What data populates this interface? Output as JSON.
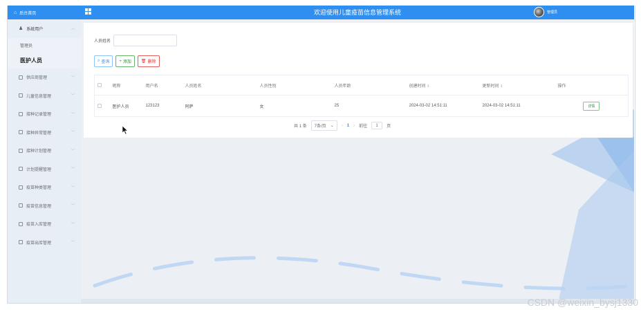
{
  "sidebar": {
    "home_label": "后台首页",
    "menus": [
      {
        "label": "系统用户",
        "open": true,
        "icon": "user-icon"
      },
      {
        "label": "供应商管理"
      },
      {
        "label": "儿童信息管理"
      },
      {
        "label": "接种记录管理"
      },
      {
        "label": "接种异常管理"
      },
      {
        "label": "接种计划管理"
      },
      {
        "label": "计划提醒管理"
      },
      {
        "label": "疫苗种类管理"
      },
      {
        "label": "疫苗信息管理"
      },
      {
        "label": "疫苗入库管理"
      },
      {
        "label": "疫苗出库管理"
      }
    ],
    "submenus": [
      {
        "label": "管理员"
      },
      {
        "label": "医护人员",
        "active": true
      }
    ]
  },
  "header": {
    "title": "欢迎使用儿童疫苗信息管理系统",
    "username": "管理员"
  },
  "search": {
    "label": "人员姓名",
    "value": "",
    "placeholder": ""
  },
  "buttons": {
    "query": "查询",
    "add": "添加",
    "delete": "删除"
  },
  "table": {
    "columns": [
      "",
      "昵称",
      "用户名",
      "人员姓名",
      "人员性别",
      "人员年龄",
      "创建时间",
      "更新时间",
      "操作"
    ],
    "sortable": [
      6,
      7
    ],
    "rows": [
      {
        "nickname": "医护人员",
        "username": "123123",
        "name": "阿萨",
        "gender": "女",
        "age": "25",
        "created": "2024-03-02 14:51:11",
        "updated": "2024-03-02 14:51:11",
        "action": "详情"
      }
    ]
  },
  "pager": {
    "total": "共 1 条",
    "page_size": "7条/页",
    "current": "1",
    "goto_label": "前往",
    "goto_value": "1",
    "page_suffix": "页"
  },
  "watermark": "CSDN @weixin_bysj1330",
  "colors": {
    "accent": "#2f8ff0",
    "sidebar_bg": "#e8eef6",
    "success": "#2e8b3b",
    "danger": "#d33333"
  }
}
